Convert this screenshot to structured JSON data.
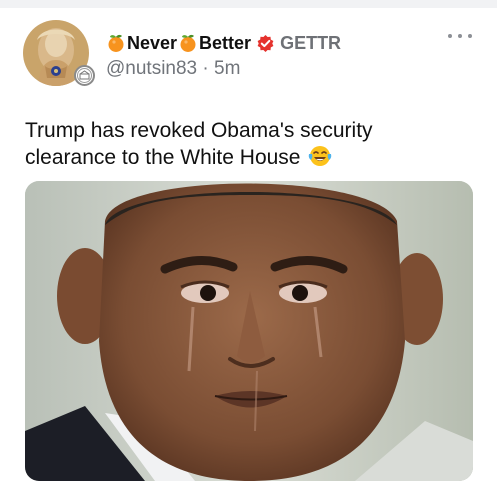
{
  "post": {
    "display_name_words": [
      "Never",
      "Better"
    ],
    "platform": "GETTR",
    "handle": "@nutsin83",
    "separator": "·",
    "time_ago": "5m",
    "text": "Trump has revoked Obama's security clearance to the White House",
    "text_emoji": "face-with-tears-of-joy-icon"
  },
  "icons": {
    "name_emoji": "tangerine-icon",
    "verified": "verified-badge-icon",
    "more": "more-options-icon",
    "avatar_badge": "profile-badge-icon"
  },
  "colors": {
    "orange": "#f7931e",
    "verified_red": "#e5322d",
    "platform_gray": "#6e7176",
    "handle_gray": "#70747a",
    "text": "#111111"
  }
}
